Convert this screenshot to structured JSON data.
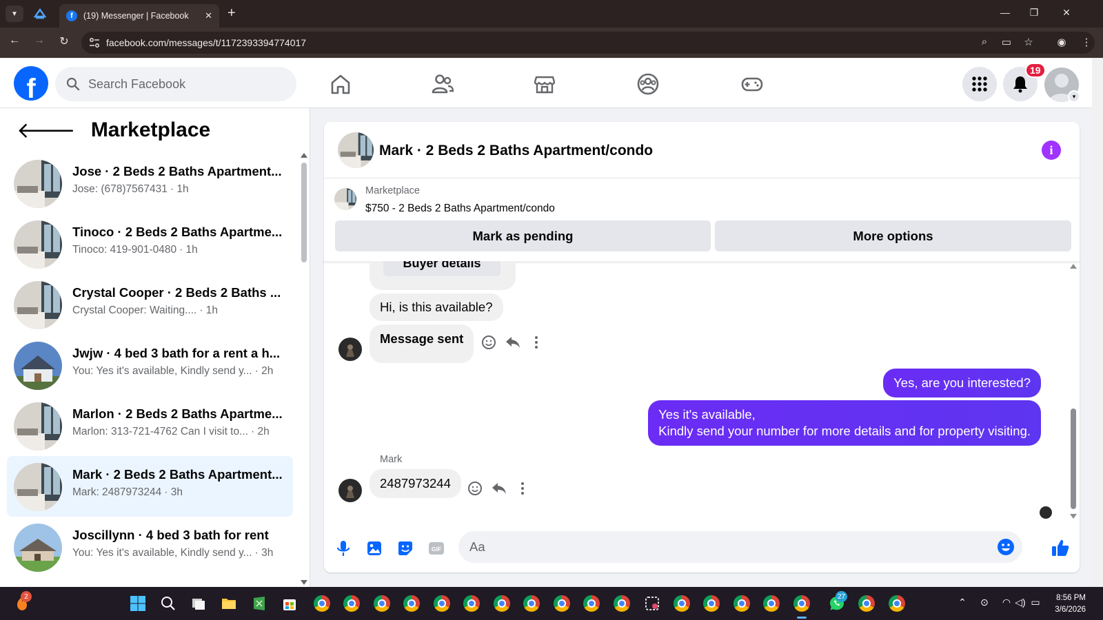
{
  "browser": {
    "tab_title": "(19) Messenger | Facebook",
    "new_tab_label": "+",
    "url": "facebook.com/messages/t/1172393394774017",
    "window_controls": [
      "minimize",
      "restore",
      "close"
    ]
  },
  "fb_nav": {
    "search_placeholder": "Search Facebook",
    "icons": [
      "home-icon",
      "friends-icon",
      "marketplace-icon",
      "groups-icon",
      "gaming-icon"
    ],
    "notification_count": "19"
  },
  "sidebar": {
    "title": "Marketplace",
    "conversations": [
      {
        "title": "Jose · 2 Beds 2 Baths Apartment...",
        "preview": "Jose: (678)7567431",
        "time": "· 1h",
        "thumb": "apartment",
        "active": false
      },
      {
        "title": "Tinoco · 2 Beds 2 Baths Apartme...",
        "preview": "Tinoco: 419-901-0480",
        "time": "· 1h",
        "thumb": "apartment",
        "active": false
      },
      {
        "title": "Crystal Cooper · 2 Beds 2 Baths ...",
        "preview": "Crystal Cooper: Waiting....",
        "time": "· 1h",
        "thumb": "apartment",
        "active": false
      },
      {
        "title": "Jwjw · 4 bed 3 bath for a rent a h...",
        "preview": "You: Yes it's available, Kindly send y...",
        "time": "· 2h",
        "thumb": "house-blue",
        "active": false
      },
      {
        "title": "Marlon · 2 Beds 2 Baths Apartme...",
        "preview": "Marlon: 313-721-4762 Can I visit to...",
        "time": "· 2h",
        "thumb": "apartment",
        "active": false
      },
      {
        "title": "Mark · 2 Beds 2 Baths Apartment...",
        "preview": "Mark: 2487973244",
        "time": "· 3h",
        "thumb": "apartment",
        "active": true
      },
      {
        "title": "Joscillynn · 4 bed 3 bath for rent",
        "preview": "You: Yes it's available, Kindly send y...",
        "time": "· 3h",
        "thumb": "house-green",
        "active": false
      }
    ]
  },
  "chat": {
    "header_title": "Mark · 2 Beds 2 Baths Apartment/condo",
    "listing": {
      "category": "Marketplace",
      "name": "$750 - 2 Beds 2 Baths Apartment/condo",
      "primary_action": "Mark as pending",
      "secondary_action": "More options"
    },
    "messages": {
      "buyer_details_label": "Buyer details",
      "incoming_1": "Hi, is this available?",
      "incoming_2": "Message sent",
      "outgoing_1": "Yes, are you interested?",
      "outgoing_2_line1": "Yes it's available,",
      "outgoing_2_line2": "Kindly send your number for more details and for property visiting.",
      "sender_name": "Mark",
      "incoming_3": "2487973244"
    },
    "composer_placeholder": "Aa"
  },
  "taskbar": {
    "claude_badge": "2",
    "whatsapp_badge": "27",
    "time": "8:56 PM",
    "date": "3/6/2026"
  },
  "colors": {
    "fb_blue": "#0866ff",
    "outgoing_bubble": "#6b2cf5",
    "active_conversation": "#ebf5ff",
    "notification_red": "#e41e3f",
    "info_purple": "#a033ff"
  }
}
